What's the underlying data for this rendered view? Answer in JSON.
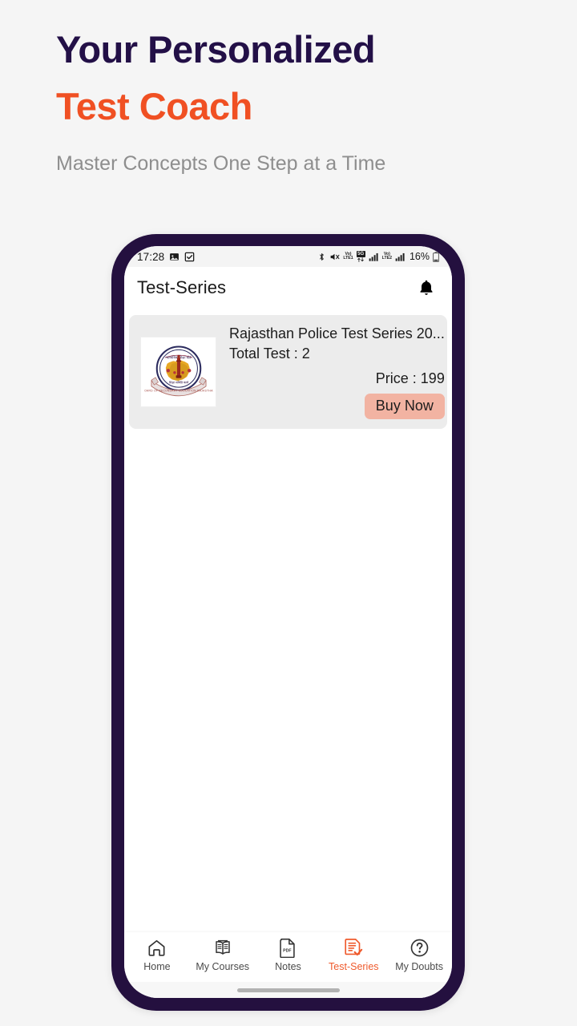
{
  "promo": {
    "headline_line1": "Your Personalized",
    "headline_line2": "Test Coach",
    "subtitle": "Master Concepts One Step at a Time",
    "color_dark": "#231047",
    "color_accent": "#f05023",
    "color_subtitle": "#8e8e8e"
  },
  "status_bar": {
    "time": "17:28",
    "left_icons": [
      "image-icon",
      "checkbox-icon"
    ],
    "right_icons": [
      "bluetooth-icon",
      "mute-icon",
      "volte1-icon",
      "5g-icon",
      "signal-bars-icon",
      "volte2-icon",
      "signal-bars-icon"
    ],
    "volte1_top": "Vo)",
    "volte1_bottom": "LTE1",
    "volte2_top": "Vo)",
    "volte2_bottom": "LTE2",
    "network_5g": "5G",
    "battery": "16%"
  },
  "app_bar": {
    "title": "Test-Series",
    "notification_icon": "bell-icon"
  },
  "test_series": [
    {
      "title": "Rajasthan Police Test Series 20...",
      "total_test_label": "Total Test : 2",
      "price_label": "Price : 199",
      "buy_label": "Buy Now",
      "thumbnail": "rajasthan-board-emblem",
      "card_bg": "#ececec",
      "buy_bg": "#f2b3a2"
    }
  ],
  "bottom_nav": {
    "active_index": 3,
    "active_color": "#ef5a2c",
    "items": [
      {
        "label": "Home",
        "icon": "home-icon"
      },
      {
        "label": "My Courses",
        "icon": "open-book-icon"
      },
      {
        "label": "Notes",
        "icon": "pdf-file-icon",
        "badge": "PDF"
      },
      {
        "label": "Test-Series",
        "icon": "document-check-icon"
      },
      {
        "label": "My Doubts",
        "icon": "question-circle-icon"
      }
    ]
  },
  "device": {
    "bezel_color": "#24103f",
    "home_indicator": true
  }
}
